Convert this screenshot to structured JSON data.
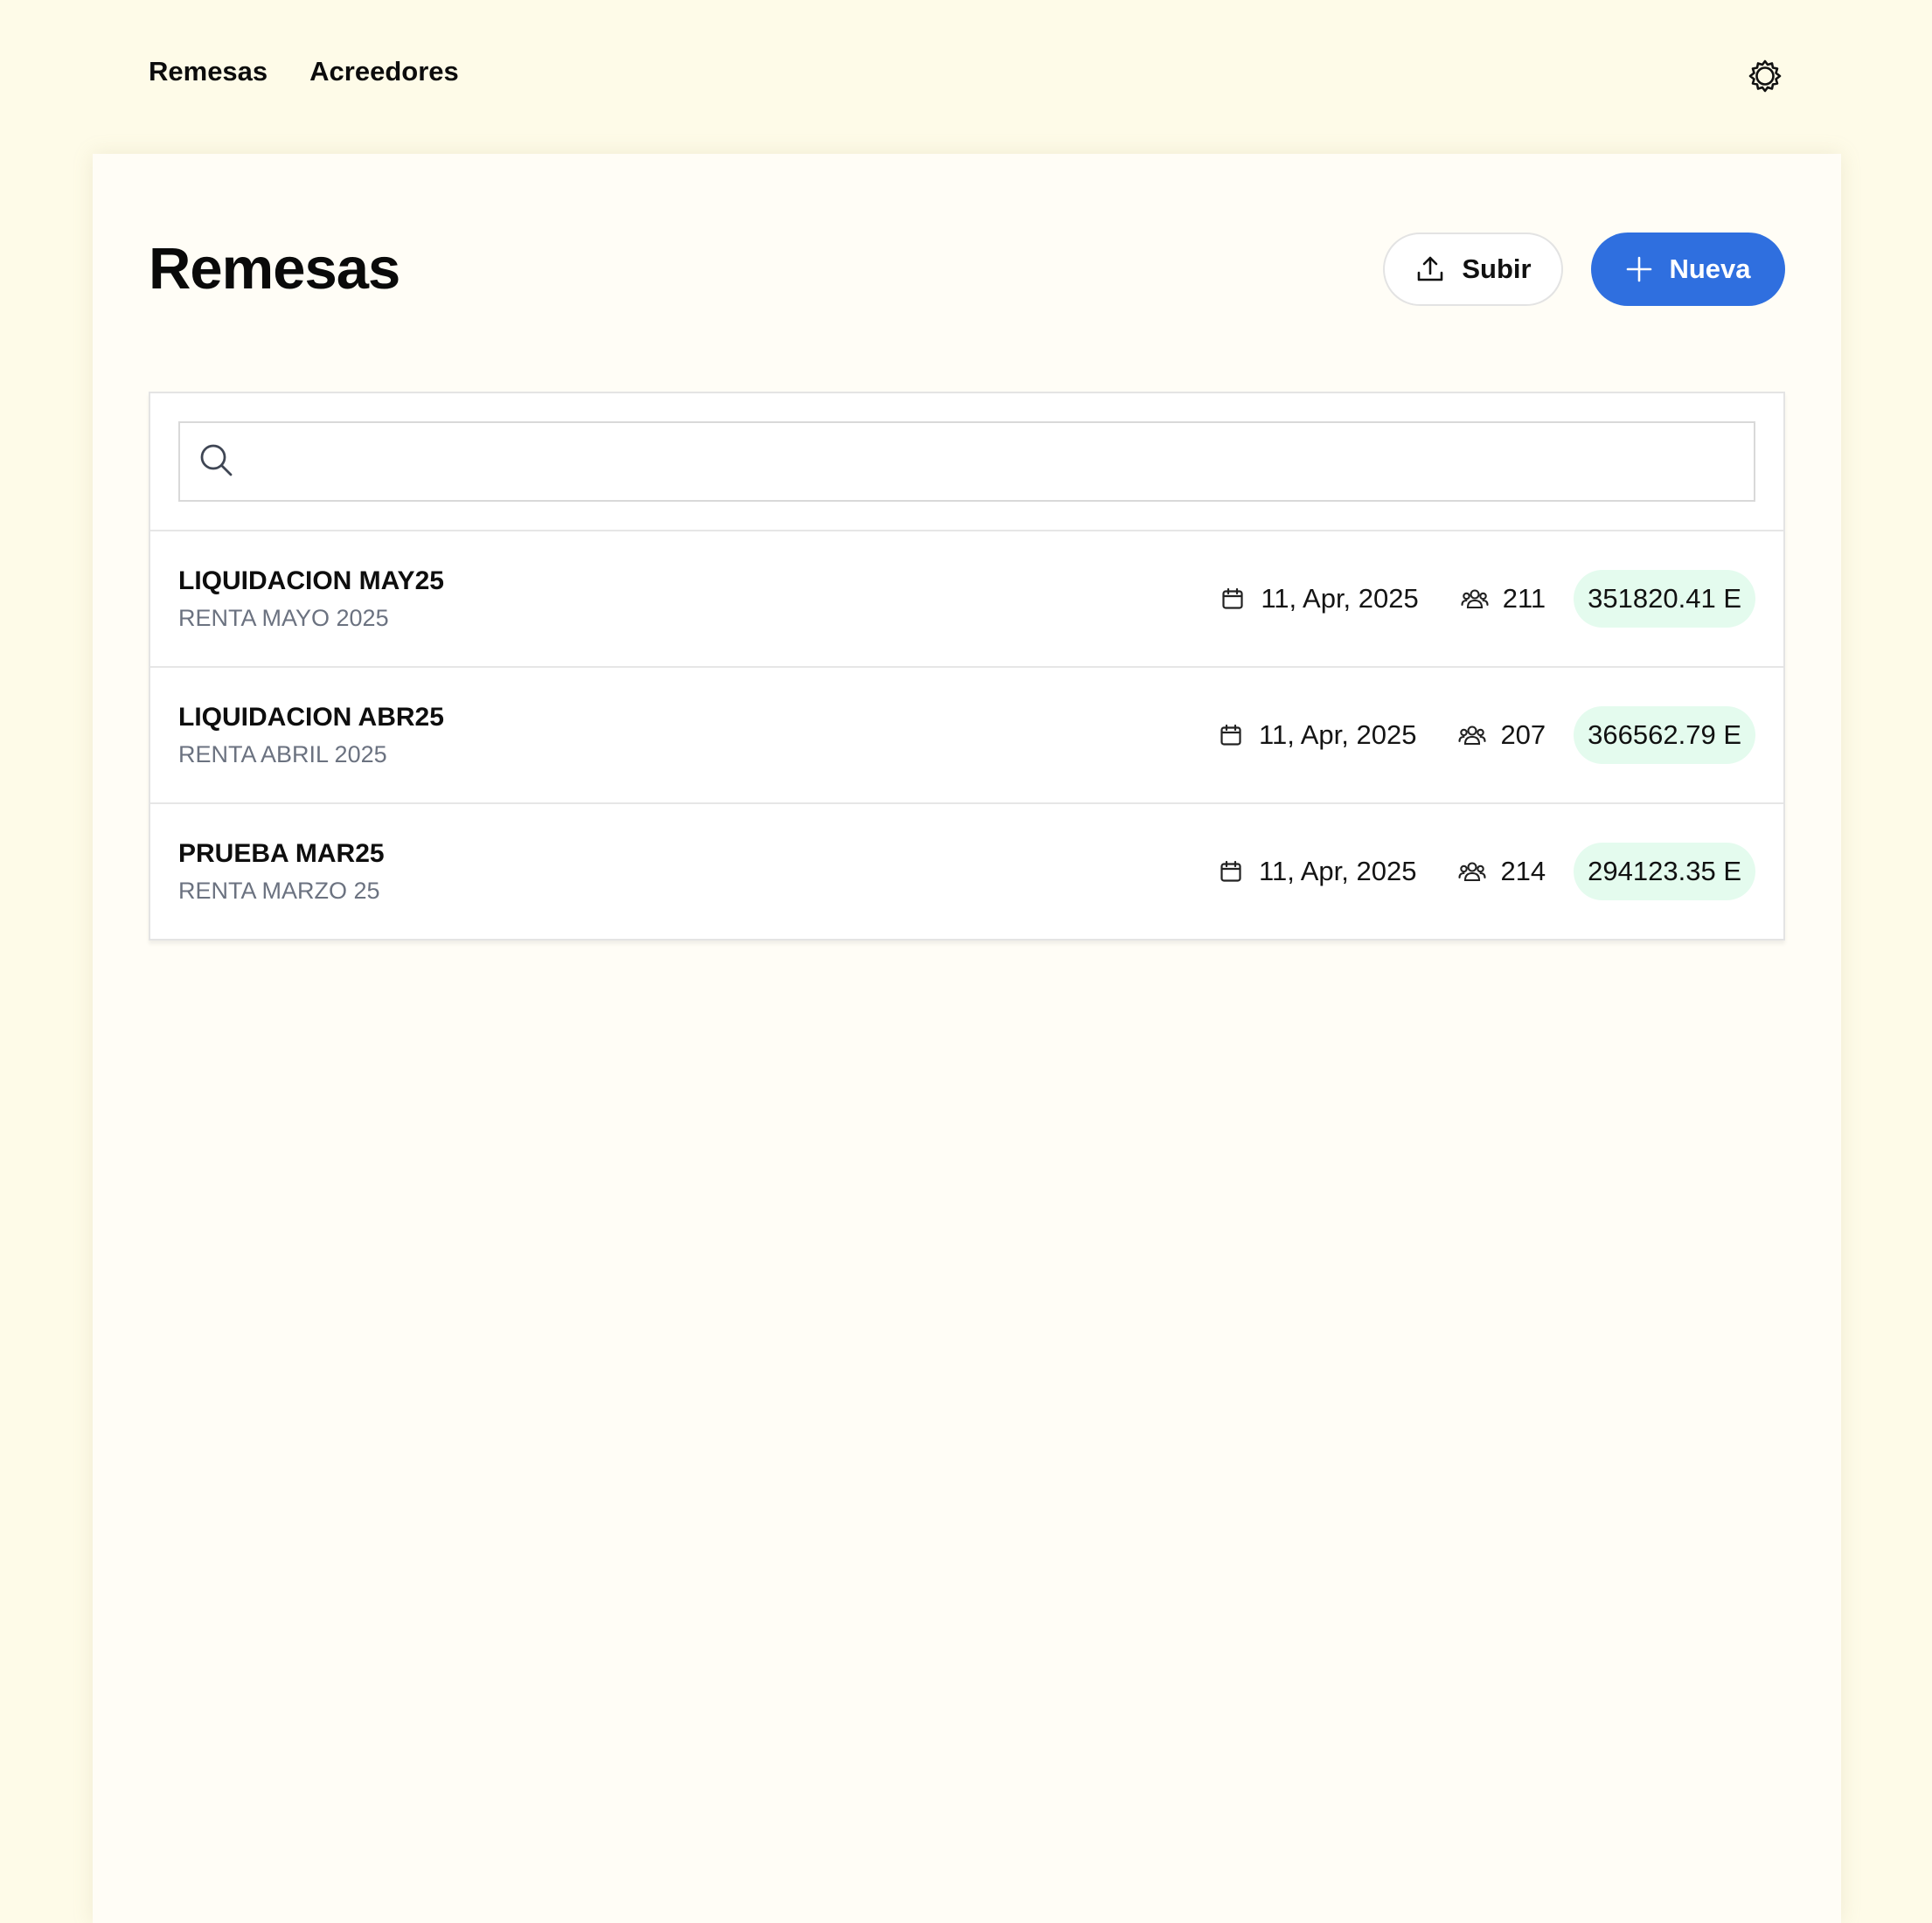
{
  "nav": {
    "items": [
      {
        "label": "Remesas"
      },
      {
        "label": "Acreedores"
      }
    ]
  },
  "page": {
    "title": "Remesas",
    "upload_label": "Subir",
    "new_label": "Nueva"
  },
  "search": {
    "placeholder": "",
    "value": ""
  },
  "remesas": [
    {
      "title": "LIQUIDACION MAY25",
      "subtitle": "RENTA MAYO 2025",
      "date": "11, Apr, 2025",
      "count": "211",
      "amount": "351820.41 E"
    },
    {
      "title": "LIQUIDACION ABR25",
      "subtitle": "RENTA ABRIL 2025",
      "date": "11, Apr, 2025",
      "count": "207",
      "amount": "366562.79 E"
    },
    {
      "title": "PRUEBA MAR25",
      "subtitle": "RENTA MARZO 25",
      "date": "11, Apr, 2025",
      "count": "214",
      "amount": "294123.35 E"
    }
  ],
  "icons": {
    "settings": "gear-icon",
    "upload": "upload-icon",
    "new": "plus-icon",
    "search": "search-icon",
    "date": "calendar-icon",
    "count": "users-icon"
  },
  "colors": {
    "background": "#fefbe8",
    "primary": "#2f6fdf",
    "amount_badge": "#e4fbee",
    "muted_text": "#6b7280"
  }
}
